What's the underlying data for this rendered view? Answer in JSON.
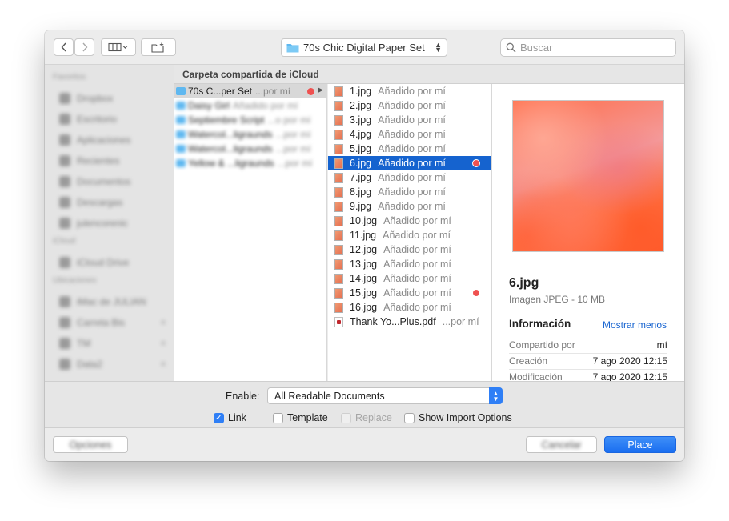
{
  "toolbar": {
    "location_label": "70s Chic Digital Paper Set",
    "search_placeholder": "Buscar"
  },
  "location_header": "Carpeta compartida de iCloud",
  "sidebar": {
    "favorites_label": "Favoritos",
    "favorites": [
      "Dropbox",
      "Escritorio",
      "Aplicaciones",
      "Recientes",
      "Documentos",
      "Descargas",
      "julencorenic"
    ],
    "icloud_label": "iCloud",
    "icloud": [
      "iCloud Drive"
    ],
    "locations_label": "Ubicaciones",
    "locations": [
      {
        "label": "iMac de JULIAN",
        "badge": ""
      },
      {
        "label": "Carreta Bis",
        "badge": "≡"
      },
      {
        "label": "TM",
        "badge": "≡"
      },
      {
        "label": "Data2",
        "badge": "≡"
      }
    ]
  },
  "column1": [
    {
      "name": "70s C...per Set",
      "status": "...por mí",
      "selected": true,
      "dot": true
    },
    {
      "name": "Daisy Girl",
      "status": "Añadido por mí",
      "selected": false,
      "dot": false
    },
    {
      "name": "Septiembre Script",
      "status": "...o por mí",
      "selected": false,
      "dot": false
    },
    {
      "name": "Watercol...ligraunds",
      "status": "...por mí",
      "selected": false,
      "dot": false
    },
    {
      "name": "Watercol...ligraunds",
      "status": "...por mí",
      "selected": false,
      "dot": false
    },
    {
      "name": "Yellow & ...ligraunds",
      "status": "...por mí",
      "selected": false,
      "dot": false
    }
  ],
  "column2": [
    {
      "name": "1.jpg",
      "status": "Añadido por mí",
      "selected": false,
      "dot": false,
      "type": "img"
    },
    {
      "name": "2.jpg",
      "status": "Añadido por mí",
      "selected": false,
      "dot": false,
      "type": "img"
    },
    {
      "name": "3.jpg",
      "status": "Añadido por mí",
      "selected": false,
      "dot": false,
      "type": "img"
    },
    {
      "name": "4.jpg",
      "status": "Añadido por mí",
      "selected": false,
      "dot": false,
      "type": "img"
    },
    {
      "name": "5.jpg",
      "status": "Añadido por mí",
      "selected": false,
      "dot": false,
      "type": "img"
    },
    {
      "name": "6.jpg",
      "status": "Añadido por mí",
      "selected": true,
      "dot": true,
      "type": "img"
    },
    {
      "name": "7.jpg",
      "status": "Añadido por mí",
      "selected": false,
      "dot": false,
      "type": "img"
    },
    {
      "name": "8.jpg",
      "status": "Añadido por mí",
      "selected": false,
      "dot": false,
      "type": "img"
    },
    {
      "name": "9.jpg",
      "status": "Añadido por mí",
      "selected": false,
      "dot": false,
      "type": "img"
    },
    {
      "name": "10.jpg",
      "status": "Añadido por mí",
      "selected": false,
      "dot": false,
      "type": "img"
    },
    {
      "name": "11.jpg",
      "status": "Añadido por mí",
      "selected": false,
      "dot": false,
      "type": "img"
    },
    {
      "name": "12.jpg",
      "status": "Añadido por mí",
      "selected": false,
      "dot": false,
      "type": "img"
    },
    {
      "name": "13.jpg",
      "status": "Añadido por mí",
      "selected": false,
      "dot": false,
      "type": "img"
    },
    {
      "name": "14.jpg",
      "status": "Añadido por mí",
      "selected": false,
      "dot": false,
      "type": "img"
    },
    {
      "name": "15.jpg",
      "status": "Añadido por mí",
      "selected": false,
      "dot": true,
      "type": "img"
    },
    {
      "name": "16.jpg",
      "status": "Añadido por mí",
      "selected": false,
      "dot": false,
      "type": "img"
    },
    {
      "name": "Thank Yo...Plus.pdf",
      "status": "...por mí",
      "selected": false,
      "dot": false,
      "type": "pdf"
    }
  ],
  "preview": {
    "name": "6.jpg",
    "kind": "Imagen JPEG - 10 MB",
    "info_title": "Información",
    "show_less": "Mostrar menos",
    "rows": [
      {
        "key": "Compartido por",
        "value": "mí"
      },
      {
        "key": "Creación",
        "value": "7 ago 2020 12:15"
      },
      {
        "key": "Modificación",
        "value": "7 ago 2020 12:15"
      }
    ]
  },
  "accessory": {
    "enable_label": "Enable:",
    "enable_value": "All Readable Documents",
    "options": [
      {
        "label": "Link",
        "checked": true,
        "disabled": false
      },
      {
        "label": "Template",
        "checked": false,
        "disabled": false
      },
      {
        "label": "Replace",
        "checked": false,
        "disabled": true
      },
      {
        "label": "Show Import Options",
        "checked": false,
        "disabled": false
      }
    ]
  },
  "footer": {
    "options_label": "Opciones",
    "cancel_label": "Cancelar",
    "place_label": "Place"
  },
  "colors": {
    "accent": "#1563cf",
    "primary_button": "#2f7ff6",
    "tag_red": "#ef5150",
    "folder_blue": "#5fb8f0"
  }
}
